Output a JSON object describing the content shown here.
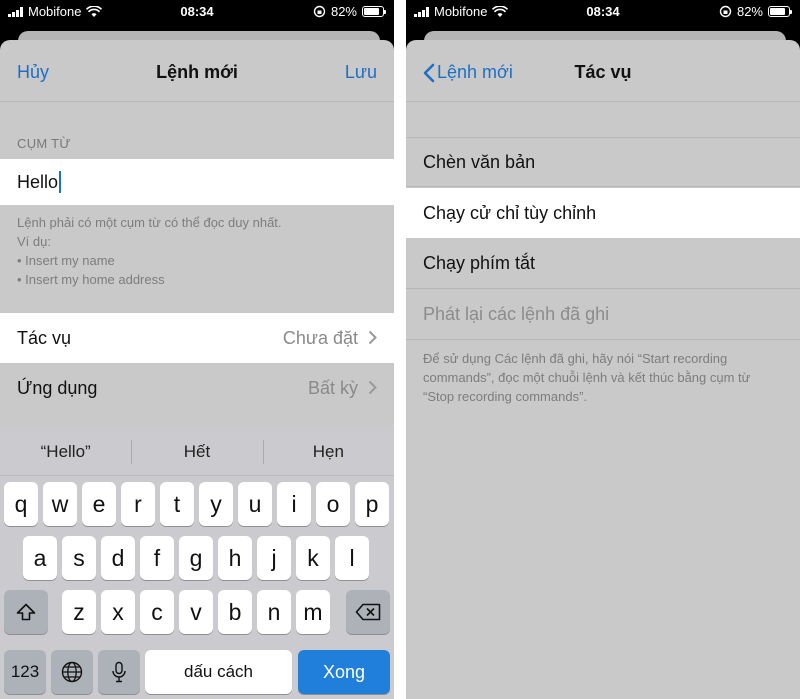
{
  "status_bar": {
    "carrier": "Mobifone",
    "time": "08:34",
    "battery": "82%"
  },
  "left": {
    "nav": {
      "cancel": "Hủy",
      "title": "Lệnh mới",
      "save": "Lưu"
    },
    "section_header": "CỤM TỪ",
    "phrase_value": "Hello",
    "footer_lines": [
      "Lệnh phải có một cụm từ có thể đọc duy nhất.",
      "Ví dụ:",
      "• Insert my name",
      "• Insert my home address"
    ],
    "rows": [
      {
        "label": "Tác vụ",
        "value": "Chưa đặt"
      },
      {
        "label": "Ứng dụng",
        "value": "Bất kỳ"
      }
    ],
    "keyboard": {
      "suggestions": [
        "“Hello”",
        "Hết",
        "Hẹn"
      ],
      "row1": [
        "q",
        "w",
        "e",
        "r",
        "t",
        "y",
        "u",
        "i",
        "o",
        "p"
      ],
      "row2": [
        "a",
        "s",
        "d",
        "f",
        "g",
        "h",
        "j",
        "k",
        "l"
      ],
      "row3": [
        "z",
        "x",
        "c",
        "v",
        "b",
        "n",
        "m"
      ],
      "numbers_label": "123",
      "space_label": "dấu cách",
      "return_label": "Xong"
    }
  },
  "right": {
    "nav": {
      "back": "Lệnh mới",
      "title": "Tác vụ"
    },
    "options": [
      "Chèn văn bản",
      "Chạy cử chỉ tùy chỉnh",
      "Chạy phím tắt",
      "Phát lại các lệnh đã ghi"
    ],
    "note_lines": [
      "Để sử dụng Các lệnh đã ghi, hãy nói “Start recording",
      "commands”, đọc một chuỗi lệnh và kết thúc bằng cụm từ",
      "“Stop recording commands”."
    ]
  },
  "colors": {
    "accent": "#1d6fc7",
    "sheet": "#c9c9c9",
    "keyboard": "#cbcbcf",
    "done_key": "#1f7fdb"
  }
}
